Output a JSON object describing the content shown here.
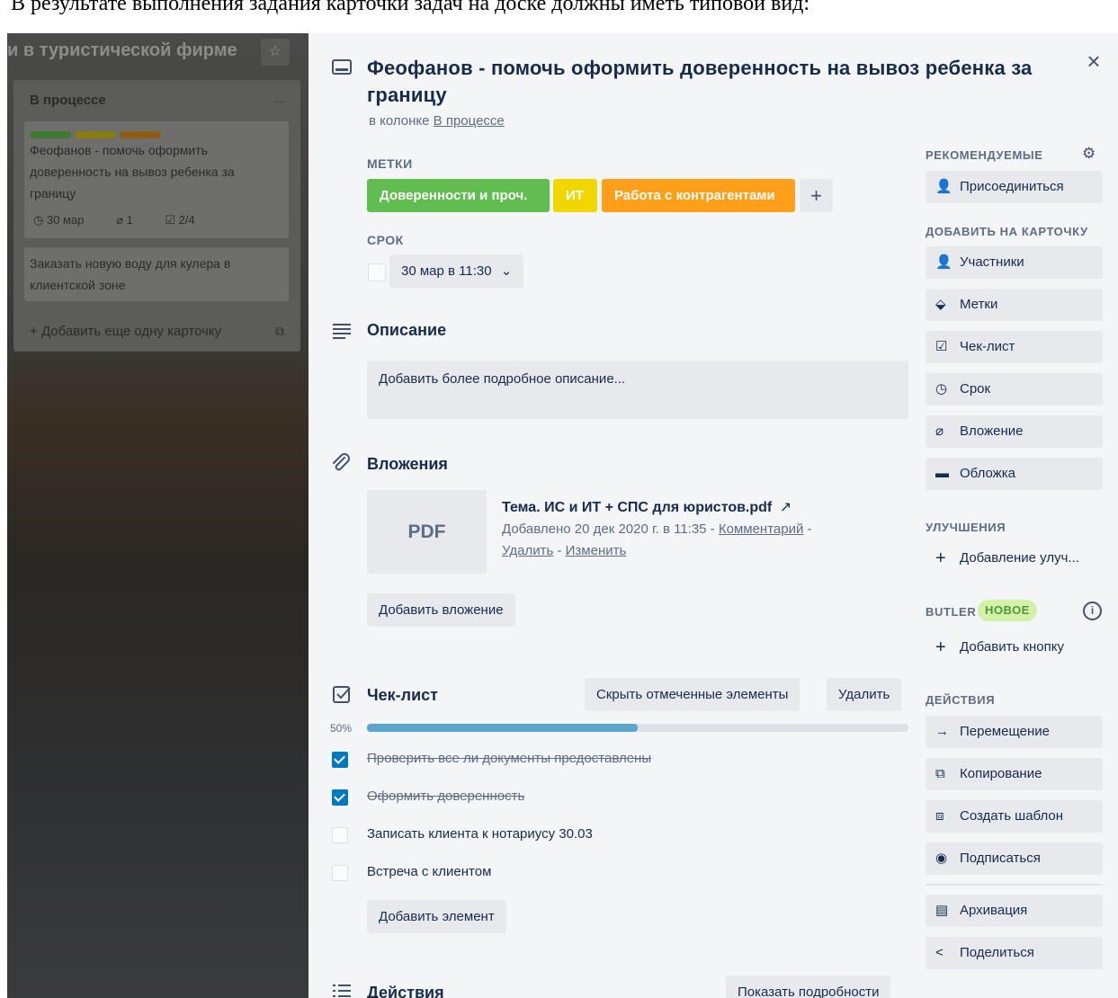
{
  "document": {
    "caption": "В результате выполнения задания карточки задач на доске должны иметь типовой вид:"
  },
  "board": {
    "title": "и в туристической фирме",
    "list": {
      "name": "В процессе",
      "menu": "...",
      "label_colors": [
        "#61bd4f",
        "#f2d600",
        "#ff9f1a"
      ],
      "cards": [
        {
          "title": "Феофанов - помочь оформить доверенность на вывоз ребенка за границу",
          "due": "30 мар",
          "attachments": "1",
          "checklist": "2/4"
        },
        {
          "title": "Заказать новую воду для кулера в клиентской зоне"
        }
      ],
      "add_card": "Добавить еще одну карточку"
    }
  },
  "card": {
    "title": "Феофанов - помочь оформить доверенность на вывоз ребенка за границу",
    "in_list_prefix": "в колонке",
    "list_name": "В процессе",
    "labels_heading": "МЕТКИ",
    "labels": [
      {
        "text": "Доверенности и проч.",
        "color": "#61bd4f"
      },
      {
        "text": "ИТ",
        "color": "#f2d600"
      },
      {
        "text": "Работа с контрагентами",
        "color": "#ff9f1a"
      }
    ],
    "add_label": "+",
    "due_heading": "СРОК",
    "due_value": "30 мар в 11:30",
    "description_heading": "Описание",
    "description_placeholder": "Добавить более подробное описание...",
    "attachments_heading": "Вложения",
    "attachment": {
      "thumb": "PDF",
      "name": "Тема. ИС и ИТ + СПС для юристов.pdf",
      "added": "Добавлено 20 дек 2020 г. в 11:35 -",
      "comment": "Комментарий",
      "dash1": "-",
      "delete": "Удалить",
      "dash2": "-",
      "edit": "Изменить"
    },
    "add_attachment": "Добавить вложение",
    "checklist_heading": "Чек-лист",
    "hide_checked": "Скрыть отмеченные элементы",
    "delete_checklist": "Удалить",
    "progress_label": "50%",
    "progress_value": 0.5,
    "checklist_items": [
      {
        "text": "Проверить все ли документы предоставлены",
        "checked": true
      },
      {
        "text": "Оформить доверенность",
        "checked": true
      },
      {
        "text": "Записать клиента к нотариусу 30.03",
        "checked": false
      },
      {
        "text": "Встреча с клиентом",
        "checked": false
      }
    ],
    "add_item": "Добавить элемент",
    "activity_heading": "Действия",
    "show_details": "Показать подробности"
  },
  "sidebar": {
    "recommended_heading": "РЕКОМЕНДУЕМЫЕ",
    "join": "Присоединиться",
    "add_to_card_heading": "ДОБАВИТЬ НА КАРТОЧКУ",
    "add_to_card": [
      "Участники",
      "Метки",
      "Чек-лист",
      "Срок",
      "Вложение",
      "Обложка"
    ],
    "powerups_heading": "УЛУЧШЕНИЯ",
    "add_powerup": "Добавление улуч...",
    "butler_heading": "BUTLER",
    "butler_badge": "НОВОЕ",
    "add_button": "Добавить кнопку",
    "actions_heading": "ДЕЙСТВИЯ",
    "actions": [
      "Перемещение",
      "Копирование",
      "Создать шаблон",
      "Подписаться"
    ],
    "actions2": [
      "Архивация",
      "Поделиться"
    ]
  }
}
